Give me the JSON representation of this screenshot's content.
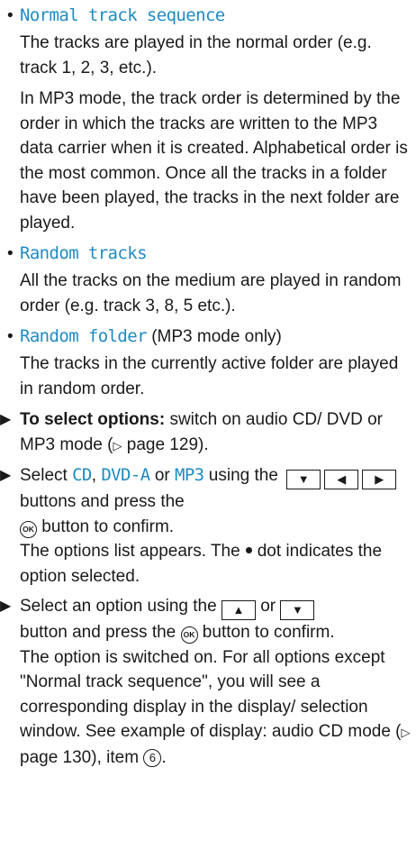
{
  "options": [
    {
      "name": "Normal track sequence",
      "paragraphs": [
        "The tracks are played in the normal order (e.g. track 1, 2, 3, etc.).",
        "In MP3 mode, the track order is determined by the order in which the tracks are written to the MP3 data carrier when it is created. Alphabetical order is the most common. Once all the tracks in a folder have been played, the tracks in the next folder are played."
      ]
    },
    {
      "name": "Random tracks",
      "paragraphs": [
        "All the tracks on the medium are played in random order (e.g. track 3, 8, 5 etc.)."
      ]
    },
    {
      "name": "Random folder",
      "note": " (MP3 mode only)",
      "paragraphs": [
        "The tracks in the currently active folder are played in random order."
      ]
    }
  ],
  "steps": {
    "step1": {
      "bold": "To select options:",
      "text": " switch on audio CD/ DVD or MP3 mode (",
      "ref": "page 129",
      "end": ")."
    },
    "step2": {
      "select": "Select ",
      "cd": "CD",
      "comma": ", ",
      "dvda": "DVD-A",
      "or": " or ",
      "mp3": "MP3",
      "using": " using the",
      "buttons_press": " buttons and press the",
      "confirm": " button to confirm.",
      "result1": "The options list appears. The",
      "result2": "dot indicates the option selected."
    },
    "step3": {
      "select": "Select an option using the",
      "or": " or ",
      "press": " button and press the",
      "confirm": " button to confirm.",
      "result": "The option is switched on. For all options except \"Normal track sequence\", you will see a corresponding display in the display/ selection window. See example of display: audio CD mode (",
      "ref": "page 130",
      "item": "), item",
      "item_num": "6",
      "end": "."
    }
  },
  "symbols": {
    "bullet": "•",
    "step_arrow": "▶",
    "ref_arrow": "▷",
    "down": "▼",
    "left": "◀",
    "right": "▶",
    "up": "▲",
    "ok": "OK"
  },
  "colors": {
    "accent": "#1e8bc3",
    "text": "#1a1a1a"
  }
}
